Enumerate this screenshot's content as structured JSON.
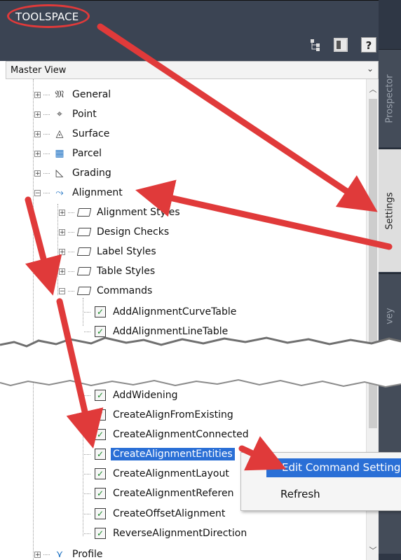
{
  "window": {
    "title": "TOOLSPACE"
  },
  "toolbar": {
    "help_label": "?"
  },
  "master_view": {
    "label": "Master View",
    "chevron": "⌄"
  },
  "side_tabs": {
    "prospector": "Prospector",
    "settings": "Settings",
    "survey": "vey"
  },
  "tree": {
    "general": "General",
    "point": "Point",
    "surface": "Surface",
    "parcel": "Parcel",
    "grading": "Grading",
    "alignment": "Alignment",
    "alignment_styles": "Alignment Styles",
    "design_checks": "Design Checks",
    "label_styles": "Label Styles",
    "table_styles": "Table Styles",
    "commands": "Commands",
    "cmd_curve_table": "AddAlignmentCurveTable",
    "cmd_line_table": "AddAlignmentLineTable",
    "cmd_widening": "AddWidening",
    "cmd_from_existing": "CreateAlignFromExisting",
    "cmd_connected": "CreateAlignmentConnected",
    "cmd_entities": "CreateAlignmentEntities",
    "cmd_layout": "CreateAlignmentLayout",
    "cmd_reference": "CreateAlignmentReferen",
    "cmd_offset": "CreateOffsetAlignment",
    "cmd_reverse": "ReverseAlignmentDirection",
    "profile": "Profile"
  },
  "context_menu": {
    "edit_command_settings": "Edit Command Setting",
    "refresh": "Refresh"
  },
  "colors": {
    "selection": "#2a6fd6",
    "annotation_arrow": "#e03a3a",
    "titlebar": "#3b4453"
  }
}
